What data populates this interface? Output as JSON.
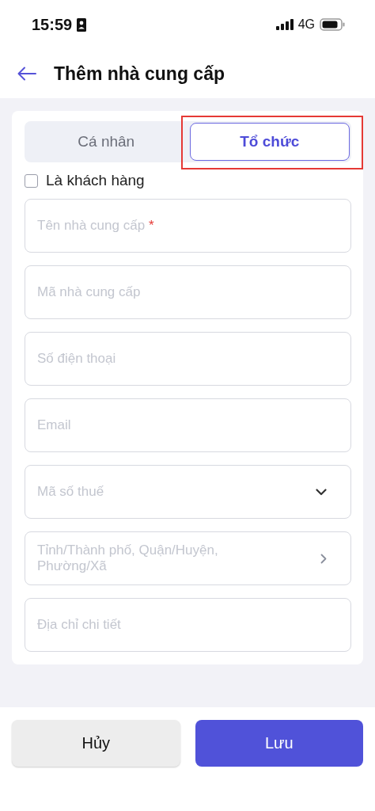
{
  "status_bar": {
    "time": "15:59",
    "network": "4G"
  },
  "header": {
    "title": "Thêm nhà cung cấp"
  },
  "tabs": [
    {
      "label": "Cá nhân",
      "selected": false,
      "highlighted": false
    },
    {
      "label": "Tổ chức",
      "selected": true,
      "highlighted": true
    }
  ],
  "customer_checkbox": {
    "label": "Là khách hàng",
    "checked": false
  },
  "fields": [
    {
      "kind": "text",
      "placeholder": "Tên nhà cung cấp",
      "required_mark": "*"
    },
    {
      "kind": "text",
      "placeholder": "Mã nhà cung cấp"
    },
    {
      "kind": "text",
      "placeholder": "Số điện thoại"
    },
    {
      "kind": "text",
      "placeholder": "Email"
    },
    {
      "kind": "select",
      "placeholder": "Mã số thuế"
    },
    {
      "kind": "picker",
      "placeholder": "Tỉnh/Thành phố, Quận/Huyện, Phường/Xã"
    },
    {
      "kind": "text",
      "placeholder": "Địa chỉ chi tiết"
    }
  ],
  "buttons": [
    {
      "label": "Hủy",
      "kind": "secondary"
    },
    {
      "label": "Lưu",
      "kind": "primary"
    }
  ]
}
